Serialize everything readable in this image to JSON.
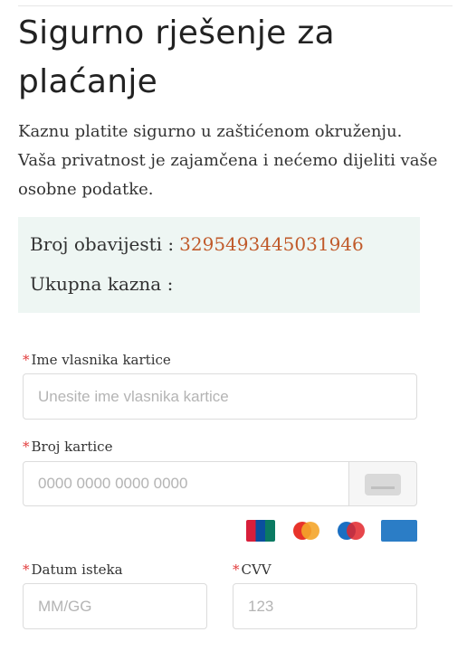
{
  "page": {
    "title": "Sigurno rješenje za plaćanje",
    "intro": "Kaznu platite sigurno u zaštićenom okruženju. Vaša privatnost je zajamčena i nećemo dijeliti vaše osobne podatke."
  },
  "notice": {
    "number_label": "Broj obavijesti :",
    "number_value": "3295493445031946",
    "total_label": "Ukupna kazna :",
    "total_value": ""
  },
  "form": {
    "required_mark": "*",
    "cardholder": {
      "label": "Ime vlasnika kartice",
      "placeholder": "Unesite ime vlasnika kartice",
      "value": ""
    },
    "card_number": {
      "label": "Broj kartice",
      "placeholder": "0000 0000 0000 0000",
      "value": ""
    },
    "expiry": {
      "label": "Datum isteka",
      "placeholder": "MM/GG",
      "value": ""
    },
    "cvv": {
      "label": "CVV",
      "placeholder": "123",
      "value": ""
    }
  },
  "card_brands": [
    {
      "icon": "unionpay-logo-icon"
    },
    {
      "icon": "mastercard-logo-icon"
    },
    {
      "icon": "maestro-logo-icon"
    },
    {
      "icon": "american-express-logo-icon"
    }
  ],
  "colors": {
    "accent_value": "#c05a2a",
    "required": "#e23b3b",
    "notice_bg": "#eef6f3"
  }
}
